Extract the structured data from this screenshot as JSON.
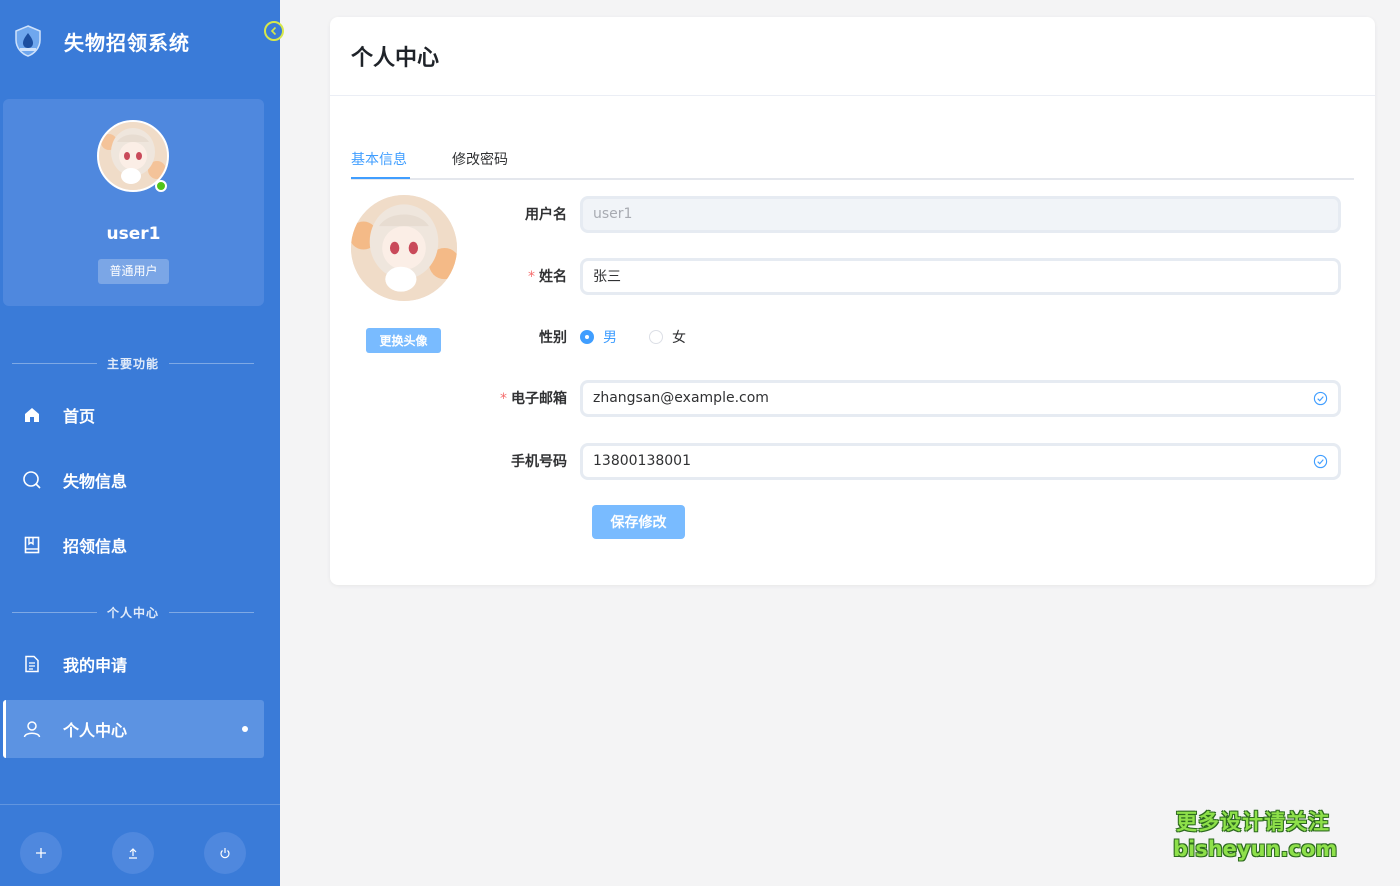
{
  "app": {
    "title": "失物招领系统"
  },
  "sidebar": {
    "user": {
      "name": "user1",
      "role": "普通用户",
      "status": "online"
    },
    "sections": {
      "main": "主要功能",
      "personal": "个人中心"
    },
    "items": [
      {
        "label": "首页",
        "icon": "home-icon"
      },
      {
        "label": "失物信息",
        "icon": "search-icon"
      },
      {
        "label": "招领信息",
        "icon": "bookmark-book-icon"
      },
      {
        "label": "我的申请",
        "icon": "document-icon"
      },
      {
        "label": "个人中心",
        "icon": "user-icon",
        "active": true
      }
    ],
    "footer_buttons": [
      {
        "icon": "plus-icon"
      },
      {
        "icon": "upload-icon"
      },
      {
        "icon": "power-icon"
      }
    ]
  },
  "page": {
    "title": "个人中心",
    "tabs": [
      {
        "label": "基本信息",
        "active": true
      },
      {
        "label": "修改密码",
        "active": false
      }
    ],
    "change_avatar_label": "更换头像",
    "form": {
      "username": {
        "label": "用户名",
        "value": "user1",
        "disabled": true
      },
      "name": {
        "label": "姓名",
        "value": "张三",
        "required": true
      },
      "gender": {
        "label": "性别",
        "options": [
          "男",
          "女"
        ],
        "selected": "男"
      },
      "email": {
        "label": "电子邮箱",
        "value": "zhangsan@example.com",
        "required": true,
        "valid": true
      },
      "phone": {
        "label": "手机号码",
        "value": "13800138001",
        "valid": true
      }
    },
    "save_label": "保存修改"
  },
  "watermark": {
    "line1": "更多设计请关注",
    "line2": "bisheyun.com"
  },
  "colors": {
    "sidebar_bg": "#3a7bd8",
    "accent": "#409eff",
    "button": "#79bbff",
    "required": "#f56c6c",
    "online": "#52c41a"
  }
}
